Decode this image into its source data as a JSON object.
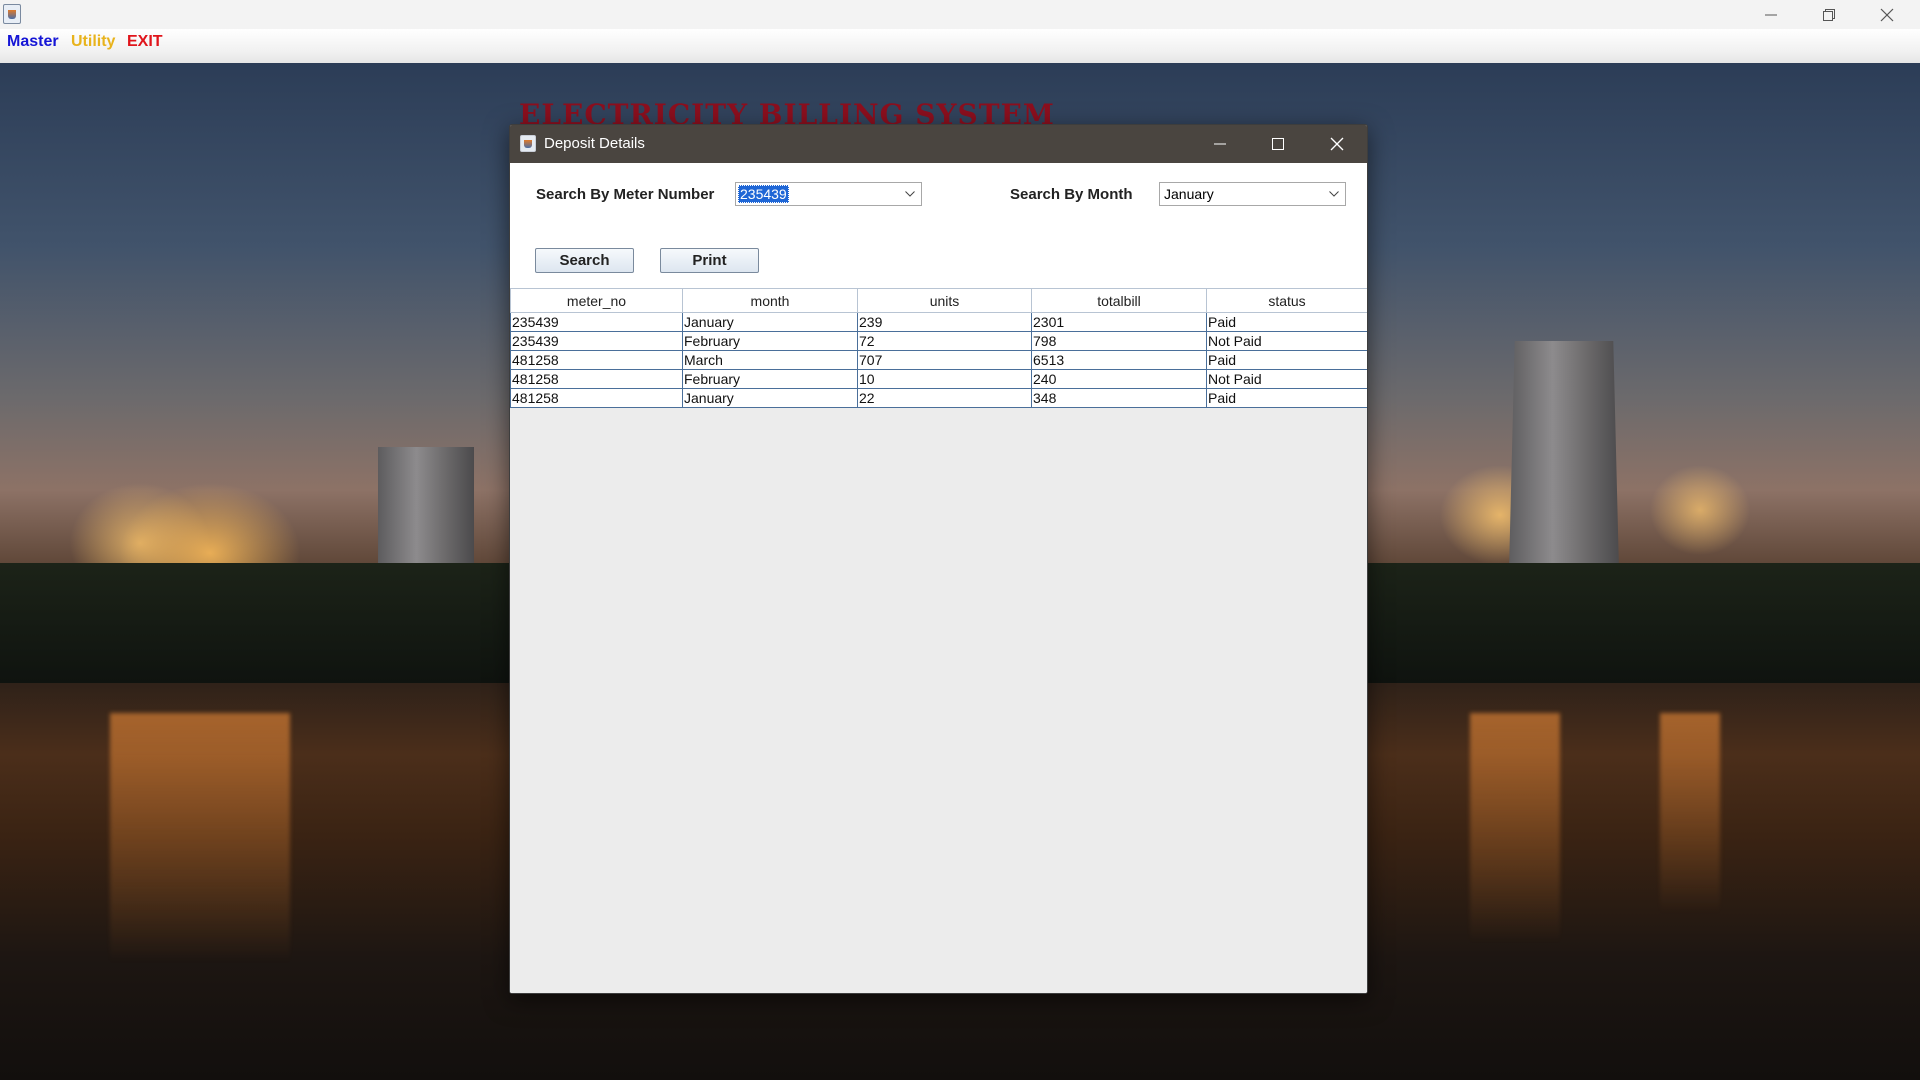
{
  "main_window": {
    "controls": {
      "minimize_icon": "minimize-icon",
      "restore_icon": "restore-icon",
      "close_icon": "close-icon"
    }
  },
  "menu": {
    "items": [
      {
        "label": "Master",
        "color": "#1515d6"
      },
      {
        "label": "Utility",
        "color": "#e8b31c"
      },
      {
        "label": "EXIT",
        "color": "#e0141b"
      }
    ]
  },
  "background": {
    "heading": "ELECTRICITY BILLING SYSTEM"
  },
  "dialog": {
    "title": "Deposit Details",
    "search_meter_label": "Search By Meter Number",
    "meter_value": "235439",
    "search_month_label": "Search By Month",
    "month_value": "January",
    "search_button": "Search",
    "print_button": "Print",
    "table": {
      "columns": [
        "meter_no",
        "month",
        "units",
        "totalbill",
        "status"
      ],
      "rows": [
        [
          "235439",
          "January",
          "239",
          "2301",
          "Paid"
        ],
        [
          "235439",
          "February",
          "72",
          "798",
          "Not Paid"
        ],
        [
          "481258",
          "March",
          "707",
          "6513",
          "Paid"
        ],
        [
          "481258",
          "February",
          "10",
          "240",
          "Not Paid"
        ],
        [
          "481258",
          "January",
          "22",
          "348",
          "Paid"
        ]
      ]
    }
  }
}
